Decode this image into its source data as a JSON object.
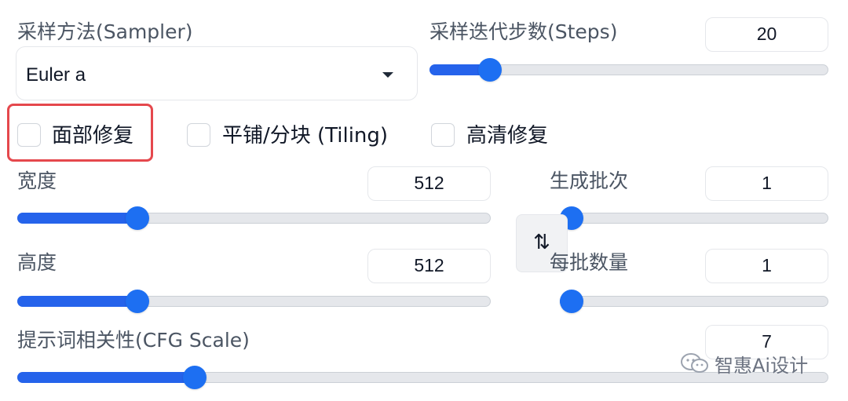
{
  "sampler": {
    "label": "采样方法(Sampler)",
    "value": "Euler a"
  },
  "steps": {
    "label": "采样迭代步数(Steps)",
    "value": "20",
    "fraction": 0.13
  },
  "checkboxes": [
    {
      "label": "面部修复",
      "checked": false,
      "highlighted": true
    },
    {
      "label": "平铺/分块 (Tiling)",
      "checked": false
    },
    {
      "label": "高清修复",
      "checked": false
    }
  ],
  "width": {
    "label": "宽度",
    "value": "512",
    "fraction": 0.24
  },
  "height": {
    "label": "高度",
    "value": "512",
    "fraction": 0.24
  },
  "batch_count": {
    "label": "生成批次",
    "value": "1",
    "fraction": 0.0
  },
  "batch_size": {
    "label": "每批数量",
    "value": "1",
    "fraction": 0.0
  },
  "cfg": {
    "label": "提示词相关性(CFG Scale)",
    "value": "7",
    "fraction": 0.21
  },
  "swap_button": {
    "symbol": "⇅"
  },
  "watermark": {
    "text": "智惠Ai设计"
  },
  "colors": {
    "accent": "#1d6ff2",
    "highlight": "#e5484d"
  }
}
